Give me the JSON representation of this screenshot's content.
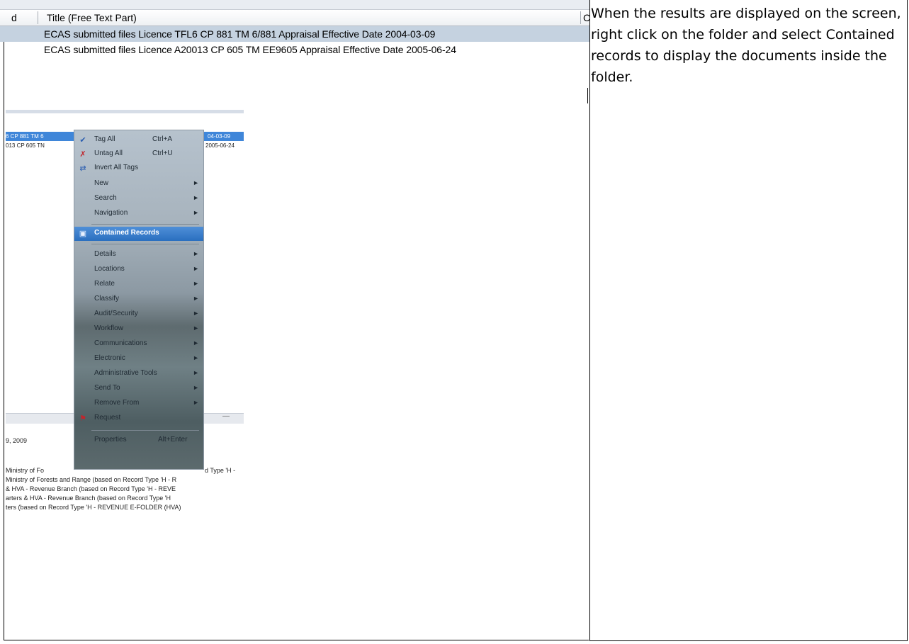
{
  "grid": {
    "header": {
      "col0": "d",
      "title": "Title (Free Text Part)",
      "col_c": "C"
    },
    "rows": [
      {
        "title": "ECAS submitted files Licence TFL6 CP 881 TM 6/881  Appraisal Effective Date 2004-03-09",
        "selected": true
      },
      {
        "title": "ECAS submitted files Licence A20013 CP 605 TM EE9605  Appraisal Effective Date 2005-06-24",
        "selected": false
      }
    ]
  },
  "context_shot": {
    "row1_left": "6 CP 881 TM 6",
    "row1_right": "04-03-09",
    "row2_left": "013 CP 605 TN",
    "row2_right": "2005-06-24",
    "date_text": "9, 2009",
    "lines": [
      "Ministry of Fo",
      "Ministry of Forests and Range (based on Record Type 'H - R",
      "& HVA - Revenue Branch (based on Record Type 'H - REVE",
      "arters & HVA - Revenue Branch (based on Record Type 'H",
      "ters (based on Record Type 'H - REVENUE E-FOLDER (HVA)"
    ],
    "line1_tail": "d Type 'H -",
    "menu": {
      "items": [
        {
          "label": "Tag All",
          "shortcut": "Ctrl+A",
          "icon": "tag-all-icon"
        },
        {
          "label": "Untag All",
          "shortcut": "Ctrl+U",
          "icon": "untag-all-icon"
        },
        {
          "label": "Invert All Tags",
          "icon": "invert-tags-icon"
        },
        {
          "label": "New",
          "submenu": true
        },
        {
          "label": "Search",
          "submenu": true
        },
        {
          "label": "Navigation",
          "submenu": true
        },
        {
          "label": "Contained Records",
          "icon": "contained-records-icon",
          "highlighted": true
        },
        {
          "label": "Details",
          "submenu": true
        },
        {
          "label": "Locations",
          "submenu": true
        },
        {
          "label": "Relate",
          "submenu": true
        },
        {
          "label": "Classify",
          "submenu": true
        },
        {
          "label": "Audit/Security",
          "submenu": true
        },
        {
          "label": "Workflow",
          "submenu": true
        },
        {
          "label": "Communications",
          "submenu": true
        },
        {
          "label": "Electronic",
          "submenu": true
        },
        {
          "label": "Administrative Tools",
          "submenu": true
        },
        {
          "label": "Send To",
          "submenu": true
        },
        {
          "label": "Remove From",
          "submenu": true
        },
        {
          "label": "Request",
          "icon": "request-icon"
        },
        {
          "label": "Properties",
          "shortcut": "Alt+Enter"
        }
      ]
    }
  },
  "instructions": "When the results are displayed on the screen, right click on the folder and select Contained records to display the documents inside the folder."
}
